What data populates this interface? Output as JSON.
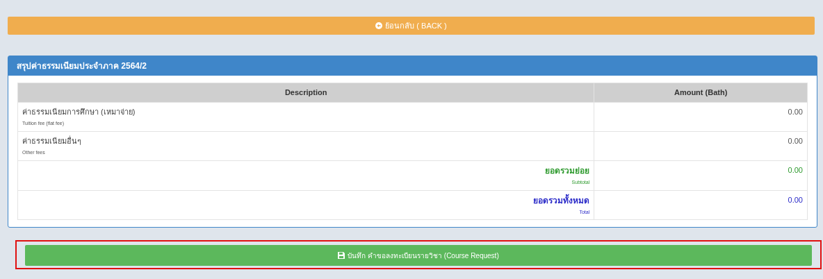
{
  "back_button": {
    "label": "ย้อนกลับ ( BACK )"
  },
  "panel": {
    "title": "สรุปค่าธรรมเนียมประจำภาค 2564/2",
    "table": {
      "columns": [
        "Description",
        "Amount (Bath)"
      ],
      "rows": [
        {
          "kind": "item",
          "label": "ค่าธรรมเนียมการศึกษา (เหมาจ่าย)",
          "sublabel": "Tuition fee (flat fee)",
          "amount": "0.00"
        },
        {
          "kind": "item",
          "label": "ค่าธรรมเนียมอื่นๆ",
          "sublabel": "Other fees",
          "amount": "0.00"
        },
        {
          "kind": "sum",
          "label": "ยอดรวมย่อย",
          "sublabel": "Subtotal",
          "amount": "0.00",
          "color": "#2e9a2e"
        },
        {
          "kind": "sum",
          "label": "ยอดรวมทั้งหมด",
          "sublabel": "Total",
          "amount": "0.00",
          "color": "#2a2ac8"
        }
      ]
    }
  },
  "save_button": {
    "label": "บันทึก คำขอลงทะเบียนรายวิชา (Course Request)",
    "highlighted": true
  }
}
